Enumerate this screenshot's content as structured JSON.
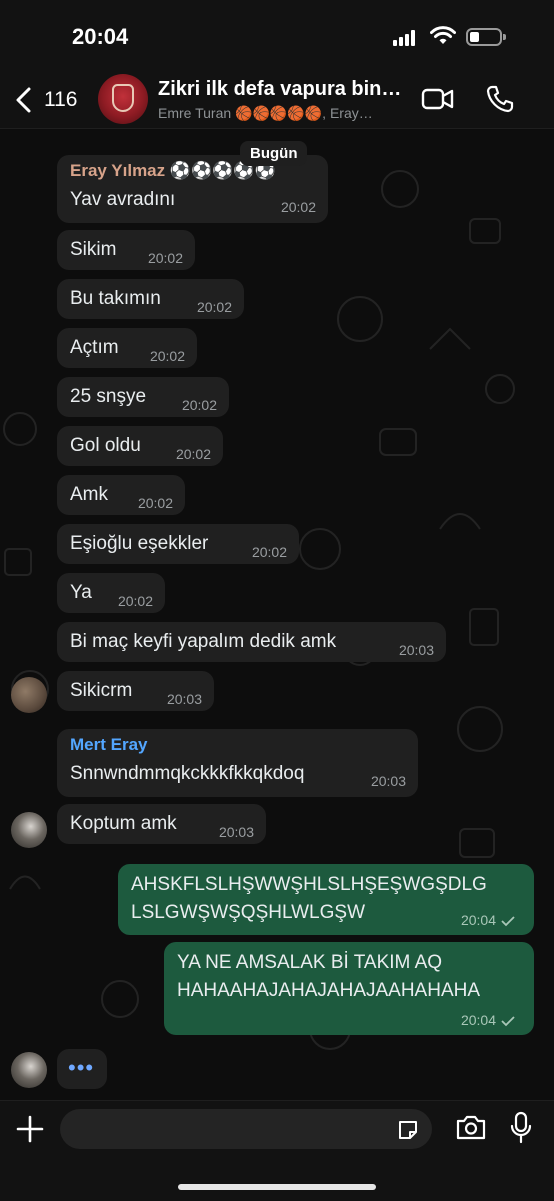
{
  "status": {
    "time": "20:04"
  },
  "header": {
    "back_count": "116",
    "title": "Zikri ilk defa vapura bin…",
    "subtitle": "Emre Turan 🏀🏀🏀🏀🏀, Eray…"
  },
  "date_separator": "Bugün",
  "messages": [
    {
      "sender": "Eray Yılmaz ⚽⚽⚽⚽⚽",
      "sender_color": "#d7a38a",
      "text": "Yav avradını",
      "time": "20:02"
    },
    {
      "text": "Sikim",
      "time": "20:02"
    },
    {
      "text": "Bu takımın",
      "time": "20:02"
    },
    {
      "text": "Açtım",
      "time": "20:02"
    },
    {
      "text": "25 snşye",
      "time": "20:02"
    },
    {
      "text": "Gol oldu",
      "time": "20:02"
    },
    {
      "text": "Amk",
      "time": "20:02"
    },
    {
      "text": "Eşioğlu eşekkler",
      "time": "20:02"
    },
    {
      "text": "Ya",
      "time": "20:02"
    },
    {
      "text": "Bi maç keyfi yapalım dedik amk",
      "time": "20:03"
    },
    {
      "text": "Sikicrm",
      "time": "20:03"
    },
    {
      "sender": "Mert Eray",
      "sender_color": "#53a6ff",
      "text": "Snnwndmmqkckkkfkkqkdoq",
      "time": "20:03"
    },
    {
      "text": "Koptum amk",
      "time": "20:03"
    },
    {
      "text_lines": [
        "AHSKFLSLHŞWWŞHLSLHŞEŞWGŞDLG",
        "LSLGWŞWŞQŞHLWLGŞW"
      ],
      "time": "20:04",
      "outgoing": true
    },
    {
      "text_lines": [
        "YA NE AMSALAK Bİ TAKIM AQ",
        "HAHAAHAJAHAJAHAJAAHAHAHA"
      ],
      "time": "20:04",
      "outgoing": true
    }
  ],
  "typing_indicator": "•••",
  "input": {
    "placeholder": ""
  },
  "colors": {
    "outgoing_bubble": "#1d5a3e",
    "incoming_bubble": "#202020",
    "accent": "#25d366"
  }
}
